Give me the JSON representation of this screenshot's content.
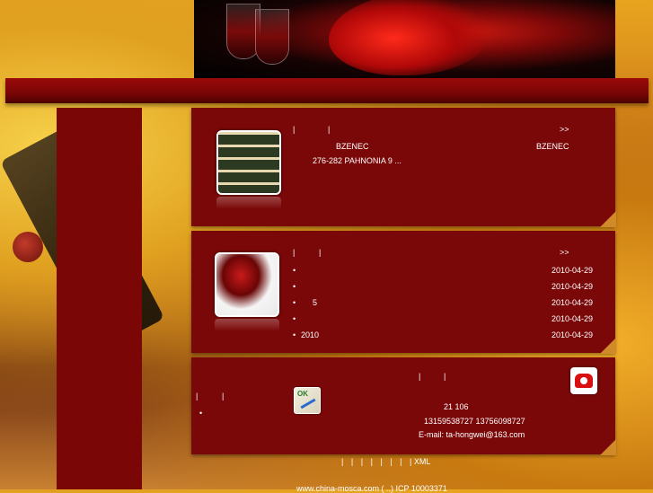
{
  "panel1": {
    "more": ">>",
    "sep1": "|",
    "sep2": "|",
    "line1_left": "BZENEC",
    "line1_right": "BZENEC",
    "line2": "276-282   PAHNONIA        9     ..."
  },
  "panel2": {
    "more": ">>",
    "sep1": "|",
    "sep2": "|",
    "items": [
      {
        "bullet": "•",
        "title": "",
        "date": "2010-04-29"
      },
      {
        "bullet": "•",
        "title": "",
        "date": "2010-04-29"
      },
      {
        "bullet": "•",
        "title": "5",
        "date": "2010-04-29"
      },
      {
        "bullet": "•",
        "title": "",
        "date": "2010-04-29"
      },
      {
        "bullet": "•",
        "title": "2010",
        "date": "2010-04-29"
      }
    ]
  },
  "panel3": {
    "left_sep1": "|",
    "left_sep2": "|",
    "left_bullet": "•",
    "sep1": "|",
    "sep2": "|",
    "address": "21 106",
    "phones": "13159538727 13756098727",
    "email": "E-mail: ta-hongwei@163.com",
    "ok_label": "OK"
  },
  "footer": {
    "links": [
      "|",
      "|",
      "|",
      "|",
      "|",
      "|",
      "|",
      "| XML"
    ],
    "copyright": "www.china-mosca.com (  ..)                              ICP 10003371"
  },
  "colors": {
    "panel": "#7a0808",
    "bar": "#8a0808",
    "accent": "#d08a2a"
  }
}
